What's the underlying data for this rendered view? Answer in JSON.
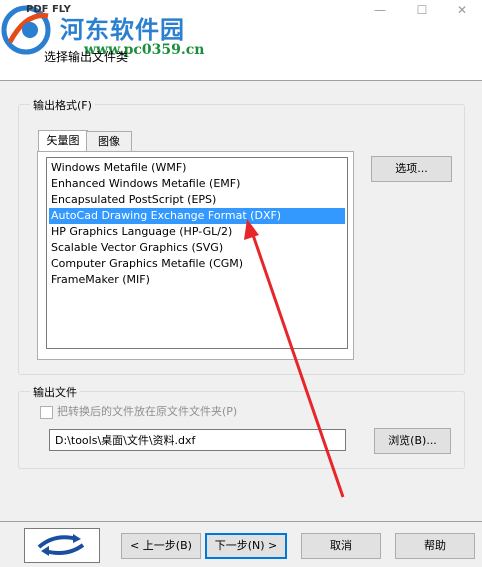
{
  "title_bar": {
    "app_title": "PDF FLY",
    "minimize": "—",
    "maximize": "☐",
    "close": "✕"
  },
  "watermark": {
    "name": "河东软件园",
    "url": "www.pc0359.cn"
  },
  "header": {
    "subtitle": "选择输出文件类"
  },
  "output_format": {
    "group_label": "输出格式(F)",
    "tabs": [
      "矢量图",
      "图像"
    ],
    "active_tab": 0,
    "formats": [
      "Windows Metafile (WMF)",
      "Enhanced Windows Metafile (EMF)",
      "Encapsulated PostScript (EPS)",
      "AutoCad Drawing Exchange Format (DXF)",
      "HP Graphics Language (HP-GL/2)",
      "Scalable Vector Graphics (SVG)",
      "Computer Graphics Metafile (CGM)",
      "FrameMaker (MIF)"
    ],
    "selected_index": 3,
    "options_button": "选项..."
  },
  "output_file": {
    "group_label": "输出文件",
    "checkbox_label": "把转换后的文件放在原文件文件夹(P)",
    "checkbox_checked": false,
    "path_value": "D:\\tools\\桌面\\文件\\资料.dxf",
    "browse_button": "浏览(B)..."
  },
  "footer": {
    "back_button": "< 上一步(B)",
    "next_button": "下一步(N) >",
    "cancel_button": "取消",
    "help_button": "帮助"
  },
  "colors": {
    "selection": "#3399ff",
    "annotation_arrow": "#e8262a",
    "watermark_blue": "#2a7fd0",
    "watermark_green": "#1a8f3a"
  }
}
